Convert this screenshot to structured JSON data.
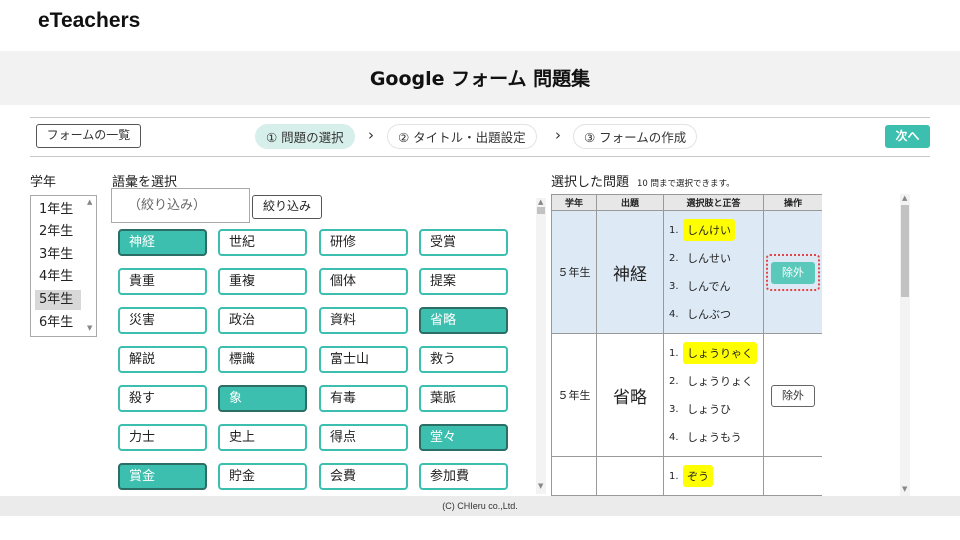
{
  "brand": "eTeachers",
  "page_title": "Google フォーム 問題集",
  "toolbar": {
    "form_list_label": "フォームの一覧",
    "next_label": "次へ"
  },
  "steps": [
    {
      "label": "① 問題の選択",
      "active": true
    },
    {
      "label": "② タイトル・出題設定",
      "active": false
    },
    {
      "label": "③ フォームの作成",
      "active": false
    }
  ],
  "grade": {
    "label": "学年",
    "options": [
      "1年生",
      "2年生",
      "3年生",
      "4年生",
      "5年生",
      "6年生"
    ],
    "selected": "5年生"
  },
  "vocab": {
    "label": "語彙を選択",
    "filter_placeholder": "（絞り込み）",
    "filter_button": "絞り込み",
    "chips": [
      {
        "text": "神経",
        "selected": true
      },
      {
        "text": "世紀",
        "selected": false
      },
      {
        "text": "研修",
        "selected": false
      },
      {
        "text": "受賞",
        "selected": false
      },
      {
        "text": "貴重",
        "selected": false
      },
      {
        "text": "重複",
        "selected": false
      },
      {
        "text": "個体",
        "selected": false
      },
      {
        "text": "提案",
        "selected": false
      },
      {
        "text": "災害",
        "selected": false
      },
      {
        "text": "政治",
        "selected": false
      },
      {
        "text": "資料",
        "selected": false
      },
      {
        "text": "省略",
        "selected": true
      },
      {
        "text": "解説",
        "selected": false
      },
      {
        "text": "標識",
        "selected": false
      },
      {
        "text": "富士山",
        "selected": false
      },
      {
        "text": "救う",
        "selected": false
      },
      {
        "text": "殺す",
        "selected": false
      },
      {
        "text": "象",
        "selected": true
      },
      {
        "text": "有毒",
        "selected": false
      },
      {
        "text": "葉脈",
        "selected": false
      },
      {
        "text": "力士",
        "selected": false
      },
      {
        "text": "史上",
        "selected": false
      },
      {
        "text": "得点",
        "selected": false
      },
      {
        "text": "堂々",
        "selected": true
      },
      {
        "text": "賞金",
        "selected": true
      },
      {
        "text": "貯金",
        "selected": false
      },
      {
        "text": "会費",
        "selected": false
      },
      {
        "text": "参加費",
        "selected": false
      }
    ]
  },
  "selected_panel": {
    "label": "選択した問題",
    "note": "10 問まで選択できます。",
    "headers": [
      "学年",
      "出題",
      "選択肢と正答",
      "操作"
    ],
    "exclude_label": "除外",
    "rows": [
      {
        "grade": "５年生",
        "word": "神経",
        "choices": [
          "しんけい",
          "しんせい",
          "しんでん",
          "しんぶつ"
        ],
        "correct": 0,
        "highlighted": true
      },
      {
        "grade": "５年生",
        "word": "省略",
        "choices": [
          "しょうりゃく",
          "しょうりょく",
          "しょうひ",
          "しょうもう"
        ],
        "correct": 0,
        "highlighted": false
      },
      {
        "grade": "",
        "word": "",
        "choices": [
          "ぞう"
        ],
        "correct": 0,
        "highlighted": false
      }
    ]
  },
  "footer": "(C) CHIeru co.,Ltd."
}
